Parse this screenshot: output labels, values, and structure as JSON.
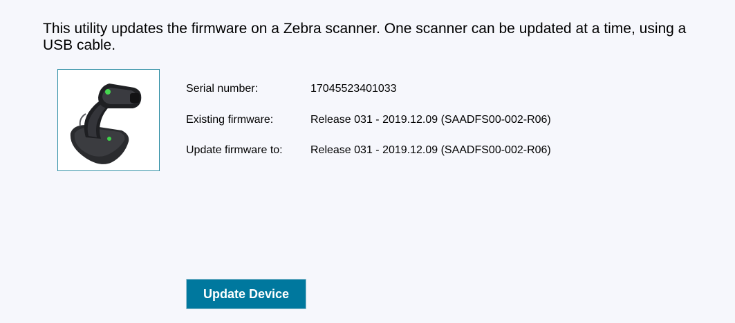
{
  "intro_text": "This utility updates the firmware on a Zebra scanner. One scanner can be updated at a time, using a USB cable.",
  "device": {
    "image_icon": "barcode-scanner-icon",
    "serial_label": "Serial number:",
    "serial_value": "17045523401033",
    "existing_label": "Existing firmware:",
    "existing_value": "Release 031 - 2019.12.09 (SAADFS00-002-R06)",
    "update_label": "Update firmware to:",
    "update_value": "Release 031 - 2019.12.09 (SAADFS00-002-R06)"
  },
  "actions": {
    "update_button_label": "Update Device"
  },
  "colors": {
    "background": "#f6f7fc",
    "button": "#00789e",
    "image_border": "#2a8ca2"
  }
}
